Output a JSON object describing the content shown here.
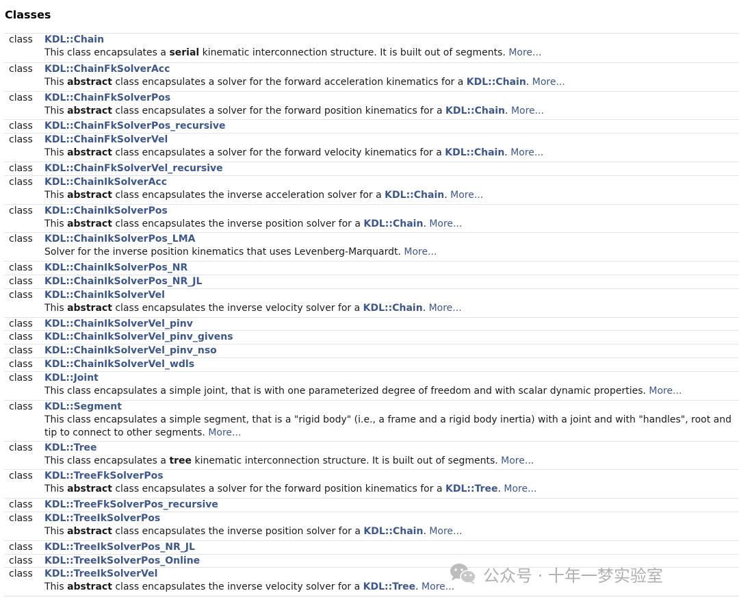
{
  "heading": "Classes",
  "keyword": "class",
  "more_label": "More...",
  "rows": [
    {
      "name": "KDL::Chain",
      "desc": [
        {
          "t": "This class encapsulates a "
        },
        {
          "b": "serial"
        },
        {
          "t": " kinematic interconnection structure. It is built out of segments. "
        }
      ],
      "lines": 2
    },
    {
      "name": "KDL::ChainFkSolverAcc",
      "desc": [
        {
          "t": "This "
        },
        {
          "b": "abstract"
        },
        {
          "t": " class encapsulates a solver for the forward acceleration kinematics for a "
        },
        {
          "l": "KDL::Chain"
        },
        {
          "t": ". "
        }
      ],
      "lines": 2
    },
    {
      "name": "KDL::ChainFkSolverPos",
      "desc": [
        {
          "t": "This "
        },
        {
          "b": "abstract"
        },
        {
          "t": " class encapsulates a solver for the forward position kinematics for a "
        },
        {
          "l": "KDL::Chain"
        },
        {
          "t": ". "
        }
      ],
      "lines": 2
    },
    {
      "name": "KDL::ChainFkSolverPos_recursive",
      "desc": null,
      "lines": 1
    },
    {
      "name": "KDL::ChainFkSolverVel",
      "desc": [
        {
          "t": "This "
        },
        {
          "b": "abstract"
        },
        {
          "t": " class encapsulates a solver for the forward velocity kinematics for a "
        },
        {
          "l": "KDL::Chain"
        },
        {
          "t": ". "
        }
      ],
      "lines": 2
    },
    {
      "name": "KDL::ChainFkSolverVel_recursive",
      "desc": null,
      "lines": 1
    },
    {
      "name": "KDL::ChainIkSolverAcc",
      "desc": [
        {
          "t": "This "
        },
        {
          "b": "abstract"
        },
        {
          "t": " class encapsulates the inverse acceleration solver for a "
        },
        {
          "l": "KDL::Chain"
        },
        {
          "t": ". "
        }
      ],
      "lines": 2
    },
    {
      "name": "KDL::ChainIkSolverPos",
      "desc": [
        {
          "t": "This "
        },
        {
          "b": "abstract"
        },
        {
          "t": " class encapsulates the inverse position solver for a "
        },
        {
          "l": "KDL::Chain"
        },
        {
          "t": ". "
        }
      ],
      "lines": 2
    },
    {
      "name": "KDL::ChainIkSolverPos_LMA",
      "desc": [
        {
          "t": "Solver for the inverse position kinematics that uses Levenberg-Marquardt. "
        }
      ],
      "lines": 2
    },
    {
      "name": "KDL::ChainIkSolverPos_NR",
      "desc": null,
      "lines": 1
    },
    {
      "name": "KDL::ChainIkSolverPos_NR_JL",
      "desc": null,
      "lines": 1
    },
    {
      "name": "KDL::ChainIkSolverVel",
      "desc": [
        {
          "t": "This "
        },
        {
          "b": "abstract"
        },
        {
          "t": " class encapsulates the inverse velocity solver for a "
        },
        {
          "l": "KDL::Chain"
        },
        {
          "t": ". "
        }
      ],
      "lines": 2
    },
    {
      "name": "KDL::ChainIkSolverVel_pinv",
      "desc": null,
      "lines": 1
    },
    {
      "name": "KDL::ChainIkSolverVel_pinv_givens",
      "desc": null,
      "lines": 1
    },
    {
      "name": "KDL::ChainIkSolverVel_pinv_nso",
      "desc": null,
      "lines": 1
    },
    {
      "name": "KDL::ChainIkSolverVel_wdls",
      "desc": null,
      "lines": 1
    },
    {
      "name": "KDL::Joint",
      "desc": [
        {
          "t": "This class encapsulates a simple joint, that is with one parameterized degree of freedom and with scalar dynamic properties. "
        }
      ],
      "lines": 2
    },
    {
      "name": "KDL::Segment",
      "desc": [
        {
          "t": "This class encapsulates a simple segment, that is a \"rigid body\" (i.e., a frame and a rigid body inertia) with a joint and with \"handles\", root and tip to connect to other segments. "
        }
      ],
      "lines": 3
    },
    {
      "name": "KDL::Tree",
      "desc": [
        {
          "t": "This class encapsulates a "
        },
        {
          "b": "tree"
        },
        {
          "t": " kinematic interconnection structure. It is built out of segments. "
        }
      ],
      "lines": 2
    },
    {
      "name": "KDL::TreeFkSolverPos",
      "desc": [
        {
          "t": "This "
        },
        {
          "b": "abstract"
        },
        {
          "t": " class encapsulates a solver for the forward position kinematics for a "
        },
        {
          "l": "KDL::Tree"
        },
        {
          "t": ". "
        }
      ],
      "lines": 2
    },
    {
      "name": "KDL::TreeFkSolverPos_recursive",
      "desc": null,
      "lines": 1
    },
    {
      "name": "KDL::TreeIkSolverPos",
      "desc": [
        {
          "t": "This "
        },
        {
          "b": "abstract"
        },
        {
          "t": " class encapsulates the inverse position solver for a "
        },
        {
          "l": "KDL::Chain"
        },
        {
          "t": ". "
        }
      ],
      "lines": 2
    },
    {
      "name": "KDL::TreeIkSolverPos_NR_JL",
      "desc": null,
      "lines": 1
    },
    {
      "name": "KDL::TreeIkSolverPos_Online",
      "desc": null,
      "lines": 1
    },
    {
      "name": "KDL::TreeIkSolverVel",
      "desc": [
        {
          "t": "This "
        },
        {
          "b": "abstract"
        },
        {
          "t": " class encapsulates the inverse velocity solver for a "
        },
        {
          "l": "KDL::Tree"
        },
        {
          "t": ". "
        }
      ],
      "lines": 2
    }
  ],
  "watermark": {
    "text": "公众号 · 十年一梦实验室",
    "icon": "wechat-icon"
  }
}
